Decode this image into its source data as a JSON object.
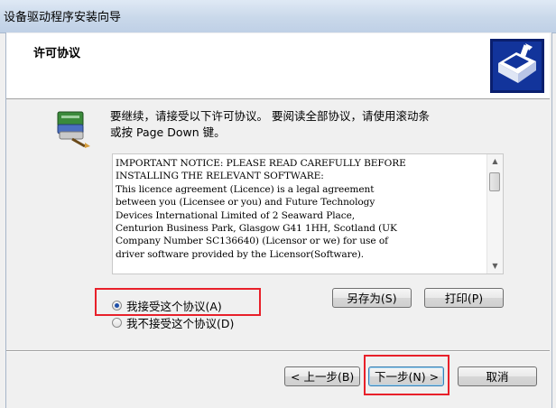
{
  "window": {
    "title": "设备驱动程序安装向导"
  },
  "header": {
    "title": "许可协议",
    "logo_icon": "setup-wizard-icon"
  },
  "instruction": {
    "line1": "要继续，请接受以下许可协议。 要阅读全部协议，请使用滚动条",
    "line2": "或按 Page Down 键。",
    "icon": "install-package-icon"
  },
  "license": {
    "text": "IMPORTANT NOTICE: PLEASE READ CAREFULLY BEFORE\nINSTALLING THE RELEVANT SOFTWARE:\nThis licence agreement (Licence) is a legal agreement\nbetween you (Licensee or you) and Future Technology\nDevices International Limited of 2 Seaward Place,\nCenturion Business Park, Glasgow G41 1HH, Scotland (UK\nCompany Number SC136640) (Licensor or we) for use of\ndriver software provided by the Licensor(Software)."
  },
  "options": {
    "accept_label": "我接受这个协议(A)",
    "decline_label": "我不接受这个协议(D)",
    "selected": "accept"
  },
  "buttons": {
    "save_as": "另存为(S)",
    "print": "打印(P)",
    "back": "< 上一步(B)",
    "next": "下一步(N) >",
    "cancel": "取消"
  },
  "colors": {
    "highlight": "#e8202a",
    "title_bar": "#c9d8ea"
  }
}
